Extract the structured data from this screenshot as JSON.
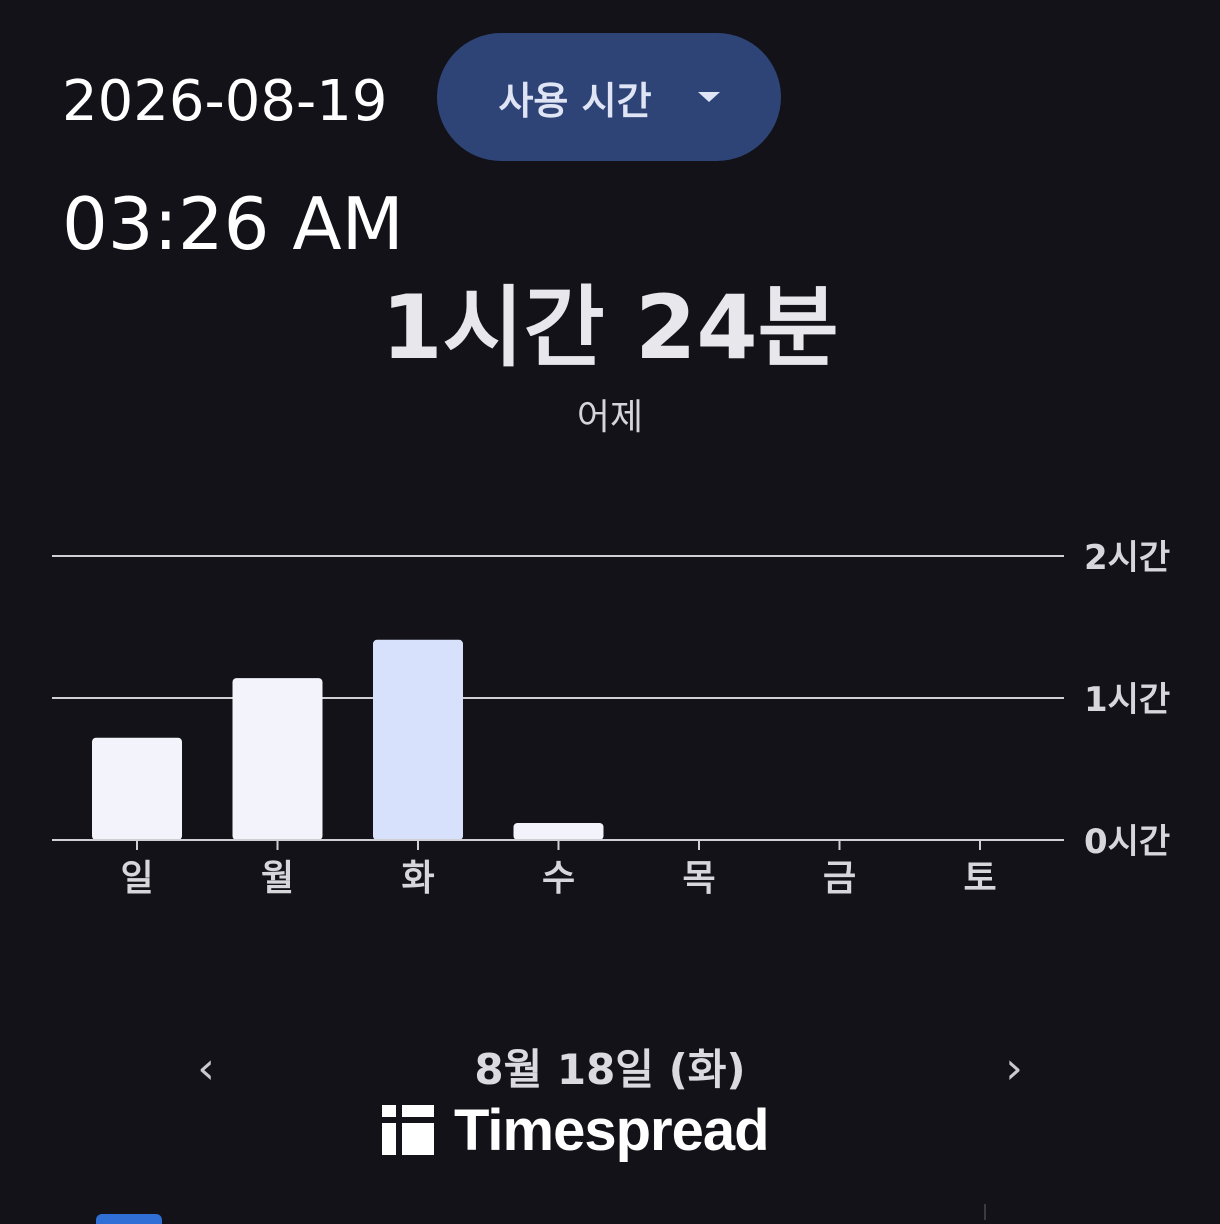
{
  "header": {
    "date": "2026-08-19",
    "time": "03:26 AM"
  },
  "dropdown": {
    "selected": "사용 시간"
  },
  "summary": {
    "total": "1시간 24분",
    "period": "어제"
  },
  "chart_data": {
    "type": "bar",
    "categories": [
      "일",
      "월",
      "화",
      "수",
      "목",
      "금",
      "토"
    ],
    "values": [
      0.72,
      1.14,
      1.41,
      0.12,
      0,
      0,
      0
    ],
    "value_unit": "hours",
    "y_tick_labels": [
      "0시간",
      "1시간",
      "2시간"
    ],
    "ylim": [
      0,
      2
    ],
    "highlighted_index": 2,
    "grid": true,
    "colors": {
      "bar": "#f2f3fb",
      "bar_highlight": "#d8e1fc",
      "gridline": "#cfcfd4"
    }
  },
  "navigation": {
    "current_date": "8월 18일 (화)",
    "prev": "‹",
    "next": "›"
  },
  "brand": {
    "name": "Timespread"
  }
}
